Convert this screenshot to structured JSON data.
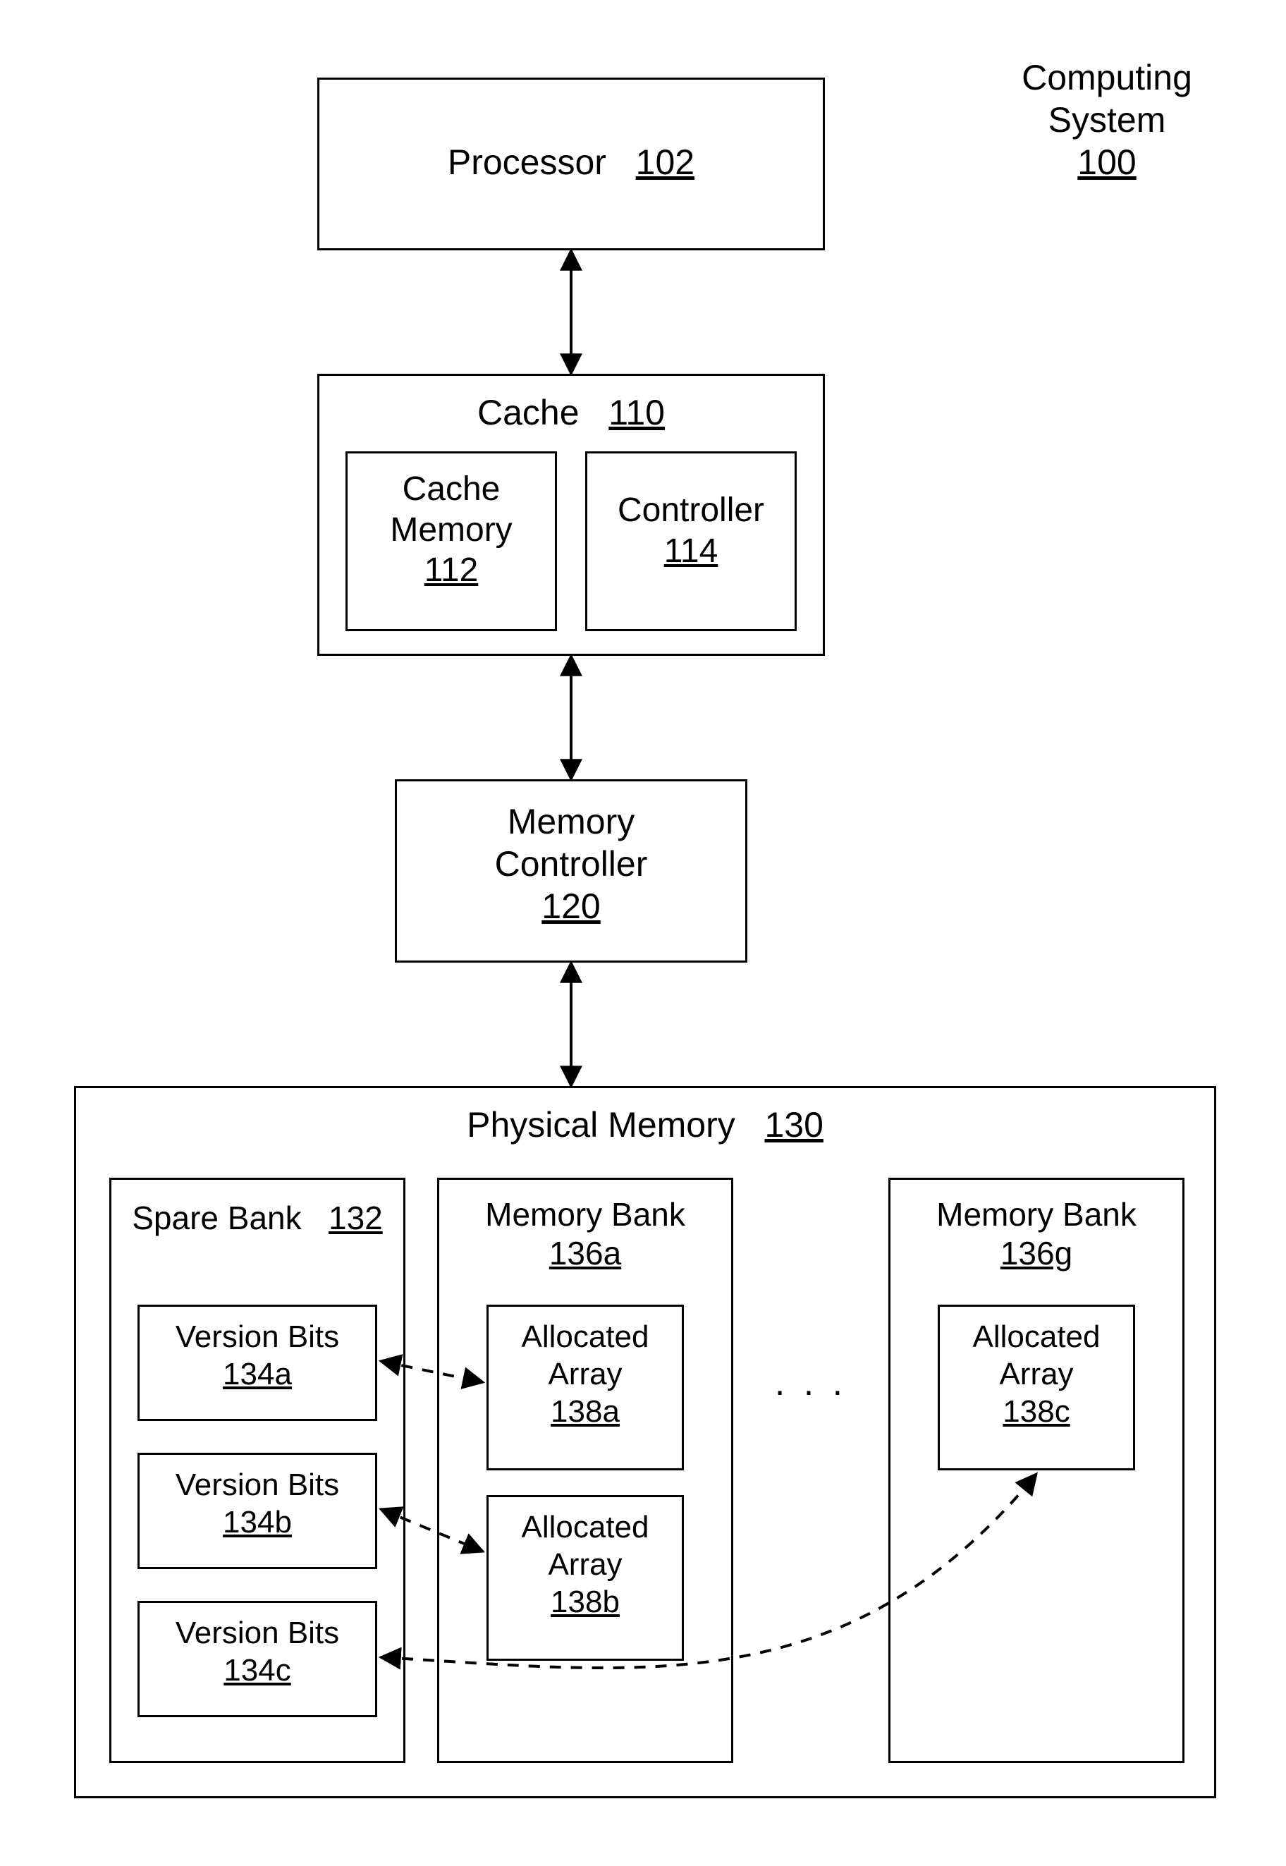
{
  "title": {
    "line1": "Computing",
    "line2": "System",
    "ref": "100"
  },
  "processor": {
    "label": "Processor",
    "ref": "102"
  },
  "cache": {
    "label": "Cache",
    "ref": "110",
    "memory": {
      "line1": "Cache",
      "line2": "Memory",
      "ref": "112"
    },
    "controller": {
      "label": "Controller",
      "ref": "114"
    }
  },
  "memctrl": {
    "line1": "Memory",
    "line2": "Controller",
    "ref": "120"
  },
  "physmem": {
    "label": "Physical Memory",
    "ref": "130",
    "spare": {
      "label": "Spare Bank",
      "ref": "132",
      "v1": {
        "label": "Version Bits",
        "ref": "134a"
      },
      "v2": {
        "label": "Version Bits",
        "ref": "134b"
      },
      "v3": {
        "label": "Version Bits",
        "ref": "134c"
      }
    },
    "bank_a": {
      "label": "Memory Bank",
      "ref": "136a",
      "a1": {
        "line1": "Allocated",
        "line2": "Array",
        "ref": "138a"
      },
      "a2": {
        "line1": "Allocated",
        "line2": "Array",
        "ref": "138b"
      }
    },
    "ellipsis": ". . .",
    "bank_g": {
      "label": "Memory Bank",
      "ref": "136g",
      "a1": {
        "line1": "Allocated",
        "line2": "Array",
        "ref": "138c"
      }
    }
  }
}
